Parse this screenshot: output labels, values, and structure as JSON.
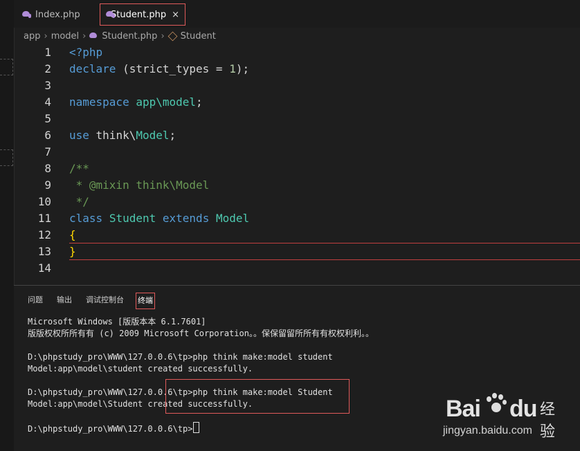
{
  "tabs": [
    {
      "label": "Index.php",
      "active": false
    },
    {
      "label": "Student.php",
      "active": true,
      "close": "×"
    }
  ],
  "breadcrumb": [
    "app",
    "model",
    "Student.php",
    "Student"
  ],
  "editor": {
    "lines": [
      {
        "num": "1"
      },
      {
        "num": "2"
      },
      {
        "num": "3"
      },
      {
        "num": "4"
      },
      {
        "num": "5"
      },
      {
        "num": "6"
      },
      {
        "num": "7"
      },
      {
        "num": "8"
      },
      {
        "num": "9"
      },
      {
        "num": "10"
      },
      {
        "num": "11"
      },
      {
        "num": "12"
      },
      {
        "num": "13"
      },
      {
        "num": "14"
      }
    ],
    "tokens": {
      "php_open": "<?php",
      "declare": "declare",
      "strict_types": " (strict_types = ",
      "one": "1",
      "close_paren": ");",
      "namespace": "namespace",
      "ns_path": "app\\model",
      "semi": ";",
      "use": "use",
      "think": " think\\",
      "model": "Model",
      "use_semi": ";",
      "c_open": "/**",
      "c_mixin": " * @mixin think\\Model",
      "c_close": " */",
      "class": "class",
      "student": "Student",
      "extends": "extends",
      "model_cls": "Model",
      "lbrace": "{",
      "rbrace": "}"
    }
  },
  "panel": {
    "tabs": [
      "问题",
      "输出",
      "调试控制台",
      "终端"
    ],
    "active_tab": "终端",
    "terminal": [
      "Microsoft Windows [版版本本 6.1.7601]",
      "版版权权所所有有 (c) 2009 Microsoft Corporation。。保保留留所所有有权权利利。。",
      "",
      "D:\\phpstudy_pro\\WWW\\127.0.0.6\\tp>php think make:model student",
      "Model:app\\model\\student created successfully.",
      "",
      "D:\\phpstudy_pro\\WWW\\127.0.0.6\\tp>php think make:model Student",
      "Model:app\\model\\Student created successfully.",
      "",
      "D:\\phpstudy_pro\\WWW\\127.0.0.6\\tp>"
    ]
  },
  "watermark": {
    "logo": "Bai",
    "logo2": "du",
    "cn": "经验",
    "url": "jingyan.baidu.com"
  },
  "colors": {
    "keyword": "#569cd6",
    "type": "#4ec9b0",
    "comment": "#6a9955",
    "highlight": "#e05a5a"
  }
}
